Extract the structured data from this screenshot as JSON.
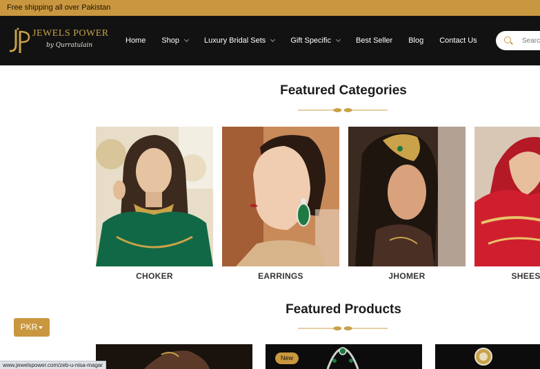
{
  "topbar": {
    "text": "Free shipping all over Pakistan"
  },
  "brand": {
    "name": "JEWELS POWER",
    "tagline": "by Qurratulain"
  },
  "nav": {
    "items": [
      {
        "label": "Home",
        "dropdown": false
      },
      {
        "label": "Shop",
        "dropdown": true
      },
      {
        "label": "Luxury Bridal Sets",
        "dropdown": true
      },
      {
        "label": "Gift Specific",
        "dropdown": true
      },
      {
        "label": "Best Seller",
        "dropdown": false
      },
      {
        "label": "Blog",
        "dropdown": false
      },
      {
        "label": "Contact Us",
        "dropdown": false
      }
    ]
  },
  "search": {
    "placeholder": "Search"
  },
  "featured_categories": {
    "title": "Featured Categories",
    "items": [
      {
        "label": "CHOKER"
      },
      {
        "label": "EARRINGS"
      },
      {
        "label": "JHOMER"
      },
      {
        "label": "SHEESH P"
      }
    ]
  },
  "featured_products": {
    "title": "Featured Products",
    "badge": "New"
  },
  "currency": {
    "label": "PKR"
  },
  "statusbar": {
    "url": "www.jewelspower.com/zeb-u-nisa-magar"
  },
  "colors": {
    "gold": "#c9973f",
    "header_bg": "#121212"
  }
}
